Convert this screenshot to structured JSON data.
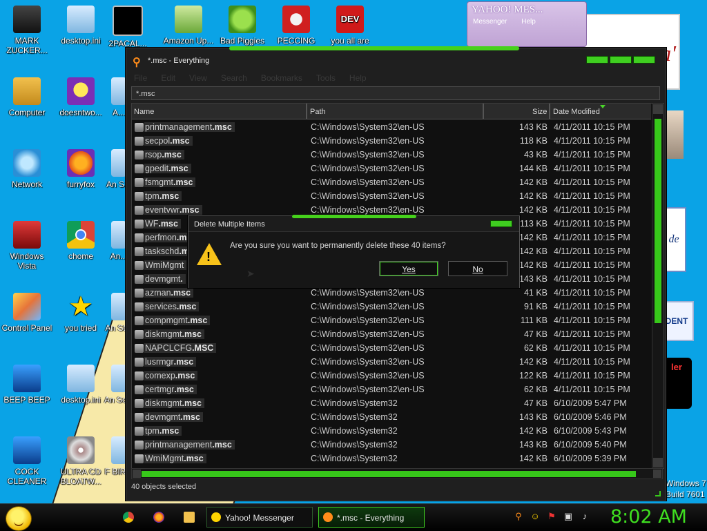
{
  "desktop": {
    "icons": [
      {
        "label": "MARK ZUCKER..."
      },
      {
        "label": "desktop.ini"
      },
      {
        "label": "2PACAL..."
      },
      {
        "label": "Amazon Up..."
      },
      {
        "label": "Bad Piggies"
      },
      {
        "label": "PECCING"
      },
      {
        "label": "you all are"
      },
      {
        "label": "Computer"
      },
      {
        "label": "doesntwo..."
      },
      {
        "label": "A..."
      },
      {
        "label": "Network"
      },
      {
        "label": "furryfox"
      },
      {
        "label": "An S..."
      },
      {
        "label": "Windows Vista"
      },
      {
        "label": "chome"
      },
      {
        "label": "An..."
      },
      {
        "label": "Control Panel"
      },
      {
        "label": "you tried"
      },
      {
        "label": "An St..."
      },
      {
        "label": "BEEP BEEP"
      },
      {
        "label": "desktop.ini"
      },
      {
        "label": "An Sc..."
      },
      {
        "label": "COCK CLEANER"
      },
      {
        "label": "ULTRA CD BLOATW..."
      },
      {
        "label": "F BIR..."
      }
    ],
    "right_badge": "DENT",
    "right_red": "ler",
    "right_card": "de",
    "promo_text": "n tma'",
    "watermark": "Windows 7\nBuild 7601",
    "yahoo_window": {
      "title": "YAHOO! MES...",
      "menu": "Messenger Help"
    }
  },
  "window": {
    "title": "*.msc - Everything",
    "menu": [
      "File",
      "Edit",
      "View",
      "Search",
      "Bookmarks",
      "Tools",
      "Help"
    ],
    "search_value": "*.msc",
    "columns": {
      "name": "Name",
      "path": "Path",
      "size": "Size",
      "date": "Date Modified"
    },
    "rows": [
      {
        "base": "printmanagement",
        "ext": ".msc",
        "path": "C:\\Windows\\System32\\en-US",
        "size": "143 KB",
        "date": "4/11/2011 10:15 PM"
      },
      {
        "base": "secpol",
        "ext": ".msc",
        "path": "C:\\Windows\\System32\\en-US",
        "size": "118 KB",
        "date": "4/11/2011 10:15 PM"
      },
      {
        "base": "rsop",
        "ext": ".msc",
        "path": "C:\\Windows\\System32\\en-US",
        "size": "43 KB",
        "date": "4/11/2011 10:15 PM"
      },
      {
        "base": "gpedit",
        "ext": ".msc",
        "path": "C:\\Windows\\System32\\en-US",
        "size": "144 KB",
        "date": "4/11/2011 10:15 PM"
      },
      {
        "base": "fsmgmt",
        "ext": ".msc",
        "path": "C:\\Windows\\System32\\en-US",
        "size": "142 KB",
        "date": "4/11/2011 10:15 PM"
      },
      {
        "base": "tpm",
        "ext": ".msc",
        "path": "C:\\Windows\\System32\\en-US",
        "size": "142 KB",
        "date": "4/11/2011 10:15 PM"
      },
      {
        "base": "eventvwr",
        "ext": ".msc",
        "path": "C:\\Windows\\System32\\en-US",
        "size": "142 KB",
        "date": "4/11/2011 10:15 PM"
      },
      {
        "base": "WF",
        "ext": ".msc",
        "path": "",
        "size": "113 KB",
        "date": "4/11/2011 10:15 PM"
      },
      {
        "base": "perfmon",
        "ext": ".m",
        "path": "",
        "size": "142 KB",
        "date": "4/11/2011 10:15 PM"
      },
      {
        "base": "taskschd",
        "ext": ".m",
        "path": "",
        "size": "142 KB",
        "date": "4/11/2011 10:15 PM"
      },
      {
        "base": "WmiMgmt",
        "ext": "",
        "path": "",
        "size": "142 KB",
        "date": "4/11/2011 10:15 PM"
      },
      {
        "base": "devmgmt",
        "ext": ".",
        "path": "",
        "size": "143 KB",
        "date": "4/11/2011 10:15 PM"
      },
      {
        "base": "azman",
        "ext": ".msc",
        "path": "C:\\Windows\\System32\\en-US",
        "size": "41 KB",
        "date": "4/11/2011 10:15 PM"
      },
      {
        "base": "services",
        "ext": ".msc",
        "path": "C:\\Windows\\System32\\en-US",
        "size": "91 KB",
        "date": "4/11/2011 10:15 PM"
      },
      {
        "base": "compmgmt",
        "ext": ".msc",
        "path": "C:\\Windows\\System32\\en-US",
        "size": "111 KB",
        "date": "4/11/2011 10:15 PM"
      },
      {
        "base": "diskmgmt",
        "ext": ".msc",
        "path": "C:\\Windows\\System32\\en-US",
        "size": "47 KB",
        "date": "4/11/2011 10:15 PM"
      },
      {
        "base": "NAPCLCFG",
        "ext": ".MSC",
        "path": "C:\\Windows\\System32\\en-US",
        "size": "62 KB",
        "date": "4/11/2011 10:15 PM"
      },
      {
        "base": "lusrmgr",
        "ext": ".msc",
        "path": "C:\\Windows\\System32\\en-US",
        "size": "142 KB",
        "date": "4/11/2011 10:15 PM"
      },
      {
        "base": "comexp",
        "ext": ".msc",
        "path": "C:\\Windows\\System32\\en-US",
        "size": "122 KB",
        "date": "4/11/2011 10:15 PM"
      },
      {
        "base": "certmgr",
        "ext": ".msc",
        "path": "C:\\Windows\\System32\\en-US",
        "size": "62 KB",
        "date": "4/11/2011 10:15 PM"
      },
      {
        "base": "diskmgmt",
        "ext": ".msc",
        "path": "C:\\Windows\\System32",
        "size": "47 KB",
        "date": "6/10/2009 5:47 PM"
      },
      {
        "base": "devmgmt",
        "ext": ".msc",
        "path": "C:\\Windows\\System32",
        "size": "143 KB",
        "date": "6/10/2009 5:46 PM"
      },
      {
        "base": "tpm",
        "ext": ".msc",
        "path": "C:\\Windows\\System32",
        "size": "142 KB",
        "date": "6/10/2009 5:43 PM"
      },
      {
        "base": "printmanagement",
        "ext": ".msc",
        "path": "C:\\Windows\\System32",
        "size": "143 KB",
        "date": "6/10/2009 5:40 PM"
      },
      {
        "base": "WmiMgmt",
        "ext": ".msc",
        "path": "C:\\Windows\\System32",
        "size": "142 KB",
        "date": "6/10/2009 5:39 PM"
      }
    ],
    "status": "40 objects selected"
  },
  "dialog": {
    "title": "Delete Multiple Items",
    "message": "Are you sure you want to permanently delete these 40 items?",
    "yes_label": "Yes",
    "no_label": "No"
  },
  "taskbar": {
    "tasks": [
      {
        "label": "Yahoo! Messenger",
        "active": false
      },
      {
        "label": "*.msc - Everything",
        "active": true
      }
    ],
    "clock": "8:02 AM"
  },
  "colors": {
    "accent_green": "#3fcf20",
    "desktop_blue": "#0aa3e6",
    "window_bg": "#1f1f1f"
  }
}
